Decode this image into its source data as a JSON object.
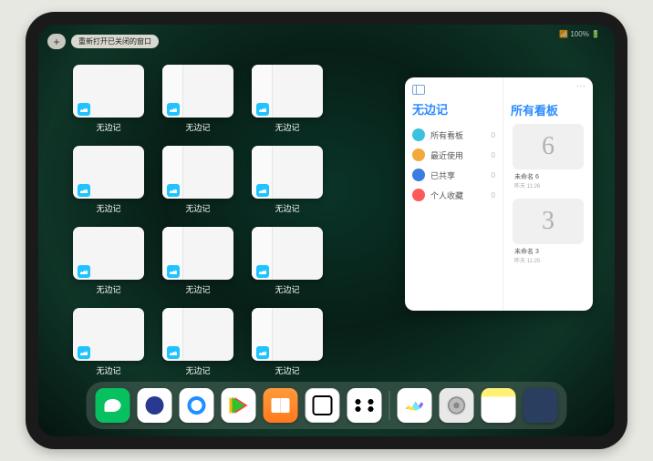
{
  "status": {
    "indicator": "📶 100% 🔋"
  },
  "top": {
    "plus": "+",
    "reopen_label": "重新打开已关闭的窗口"
  },
  "app_label": "无边记",
  "windows": [
    {
      "type": "blank"
    },
    {
      "type": "split"
    },
    {
      "type": "split"
    },
    null,
    {
      "type": "blank"
    },
    {
      "type": "split"
    },
    {
      "type": "split"
    },
    null,
    {
      "type": "blank"
    },
    {
      "type": "split"
    },
    {
      "type": "split"
    },
    null,
    {
      "type": "blank"
    },
    {
      "type": "split"
    },
    {
      "type": "split"
    },
    null
  ],
  "panel": {
    "ellipsis": "···",
    "left_title": "无边记",
    "right_title": "所有看板",
    "nav": [
      {
        "label": "所有看板",
        "count": "0",
        "color": "#3ac2e0"
      },
      {
        "label": "最近使用",
        "count": "0",
        "color": "#f2a83c"
      },
      {
        "label": "已共享",
        "count": "0",
        "color": "#3a7de0"
      },
      {
        "label": "个人收藏",
        "count": "0",
        "color": "#ff5a5a"
      }
    ],
    "boards": [
      {
        "glyph": "6",
        "label": "未命名 6",
        "sublabel": "昨天 11:26"
      },
      {
        "glyph": "3",
        "label": "未命名 3",
        "sublabel": "昨天 11:25"
      }
    ]
  },
  "dock": {
    "icons": [
      {
        "name": "wechat-icon"
      },
      {
        "name": "quark-icon"
      },
      {
        "name": "qqbrowser-icon"
      },
      {
        "name": "play-icon"
      },
      {
        "name": "books-icon"
      },
      {
        "name": "dice-icon"
      },
      {
        "name": "nodes-icon"
      }
    ],
    "right_icons": [
      {
        "name": "freeform-icon"
      },
      {
        "name": "settings-icon"
      },
      {
        "name": "notes-icon"
      },
      {
        "name": "app-library-icon"
      }
    ]
  }
}
